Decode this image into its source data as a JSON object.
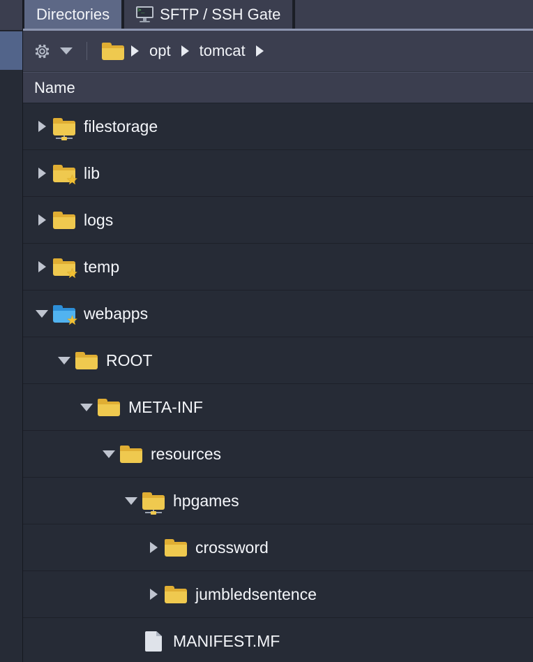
{
  "window": {
    "accent_color": "#52648a",
    "folder_color": "#efc94f",
    "folder_special_color": "#51b3f0",
    "background_color": "#262b36",
    "panel_color": "#3b3e4f"
  },
  "rail": {
    "selected_item_name": "directories-rail-item"
  },
  "tabs": [
    {
      "label": "Directories",
      "icon": "",
      "active": true
    },
    {
      "label": "SFTP / SSH Gate",
      "icon": "terminal-monitor-icon",
      "active": false
    }
  ],
  "toolbar": {
    "settings_icon": "gear-icon",
    "settings_caret": "chevron-down-icon",
    "root_folder_icon": "folder-icon",
    "breadcrumbs": [
      "opt",
      "tomcat"
    ]
  },
  "column_header": {
    "name": "Name"
  },
  "tree": [
    {
      "label": "filestorage",
      "depth": 0,
      "twisty": "right",
      "icon": "network-folder-icon",
      "starred": false
    },
    {
      "label": "lib",
      "depth": 0,
      "twisty": "right",
      "icon": "folder-icon",
      "starred": true
    },
    {
      "label": "logs",
      "depth": 0,
      "twisty": "right",
      "icon": "folder-icon",
      "starred": false
    },
    {
      "label": "temp",
      "depth": 0,
      "twisty": "right",
      "icon": "folder-icon",
      "starred": true
    },
    {
      "label": "webapps",
      "depth": 0,
      "twisty": "down",
      "icon": "folder-blue-icon",
      "starred": true
    },
    {
      "label": "ROOT",
      "depth": 1,
      "twisty": "down",
      "icon": "folder-icon",
      "starred": false
    },
    {
      "label": "META-INF",
      "depth": 2,
      "twisty": "down",
      "icon": "folder-icon",
      "starred": false
    },
    {
      "label": "resources",
      "depth": 3,
      "twisty": "down",
      "icon": "folder-icon",
      "starred": false
    },
    {
      "label": "hpgames",
      "depth": 4,
      "twisty": "down",
      "icon": "network-folder-icon",
      "starred": false
    },
    {
      "label": "crossword",
      "depth": 5,
      "twisty": "right",
      "icon": "folder-icon",
      "starred": false
    },
    {
      "label": "jumbledsentence",
      "depth": 5,
      "twisty": "right",
      "icon": "folder-icon",
      "starred": false
    },
    {
      "label": "MANIFEST.MF",
      "depth": 4,
      "twisty": "none",
      "icon": "document-icon",
      "starred": false
    }
  ]
}
